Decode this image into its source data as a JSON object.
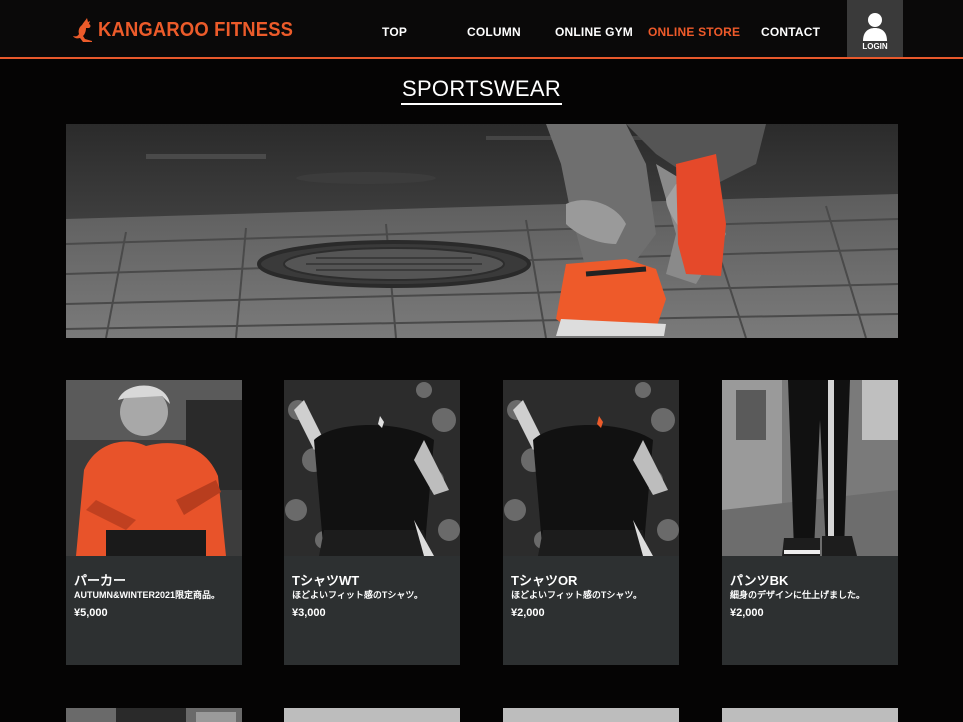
{
  "header": {
    "logo_text": "KANGAROO FITNESS",
    "nav": [
      {
        "label": "TOP",
        "active": false
      },
      {
        "label": "COLUMN",
        "active": false
      },
      {
        "label": "ONLINE GYM",
        "active": false
      },
      {
        "label": "ONLINE STORE",
        "active": true
      },
      {
        "label": "CONTACT",
        "active": false
      }
    ],
    "login_label": "LOGIN"
  },
  "page": {
    "title": "SPORTSWEAR"
  },
  "products": [
    {
      "name": "パーカー",
      "desc": "AUTUMN&WINTER2021限定商品。",
      "price": "¥5,000"
    },
    {
      "name": "TシャツWT",
      "desc": "ほどよいフィット感のTシャツ。",
      "price": "¥3,000"
    },
    {
      "name": "TシャツOR",
      "desc": "ほどよいフィット感のTシャツ。",
      "price": "¥2,000"
    },
    {
      "name": "パンツBK",
      "desc": "細身のデザインに仕上げました。",
      "price": "¥2,000"
    }
  ],
  "colors": {
    "accent": "#ec5b2a",
    "background": "#050404",
    "card": "#2d3031",
    "login_bg": "#3a3a3a"
  }
}
